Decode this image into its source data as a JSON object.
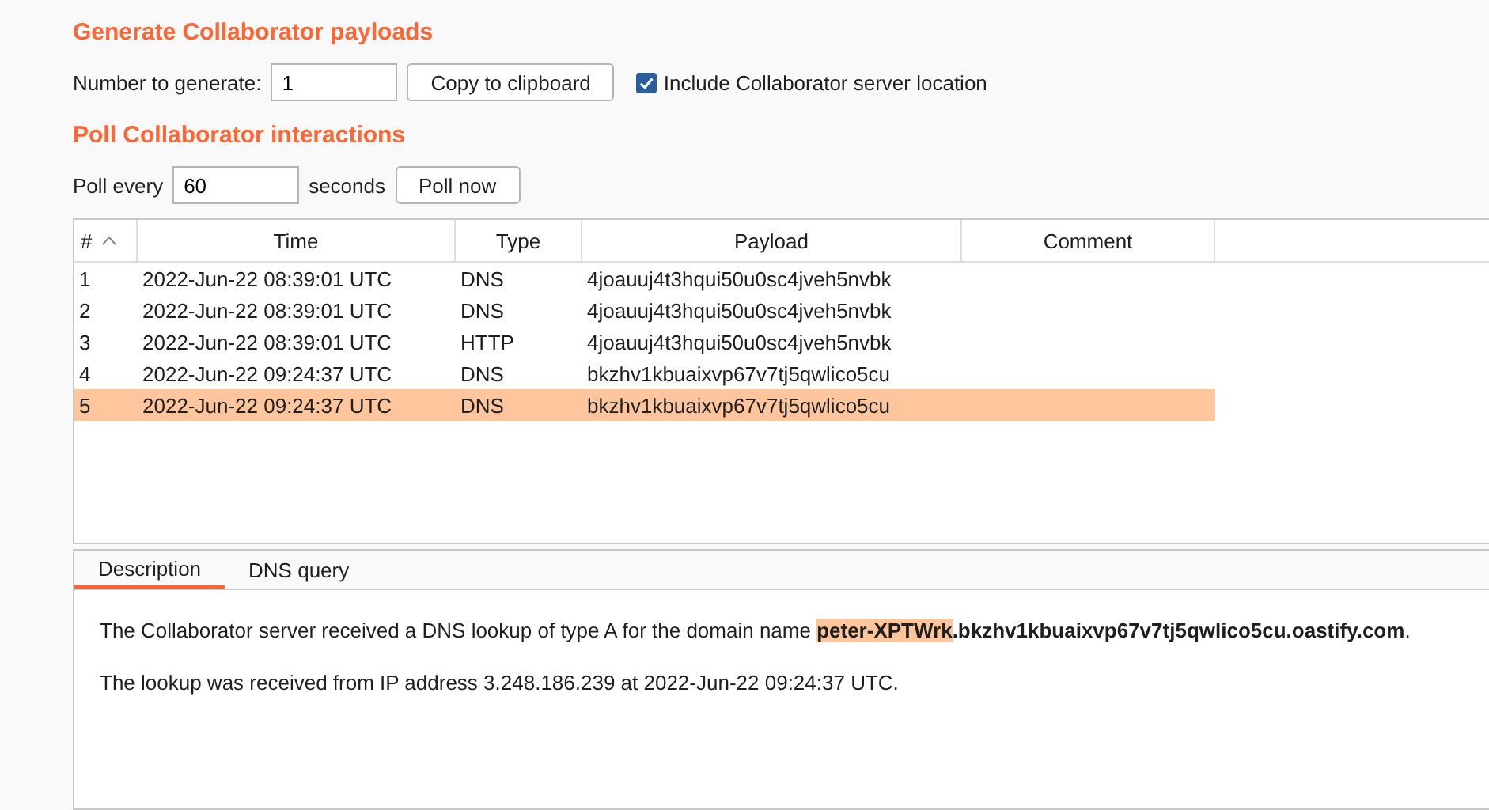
{
  "generate": {
    "title": "Generate Collaborator payloads",
    "number_label": "Number to generate:",
    "number_value": "1",
    "copy_button": "Copy to clipboard",
    "include_location": {
      "label": "Include Collaborator server location",
      "checked": true
    }
  },
  "poll": {
    "title": "Poll Collaborator interactions",
    "label_before": "Poll every",
    "interval_value": "60",
    "label_after": "seconds",
    "poll_button": "Poll now"
  },
  "table": {
    "columns": [
      "#",
      "Time",
      "Type",
      "Payload",
      "Comment"
    ],
    "rows": [
      {
        "cells": [
          "1",
          "2022-Jun-22 08:39:01 UTC",
          "DNS",
          "4joauuj4t3hqui50u0sc4jveh5nvbk",
          ""
        ],
        "selected": false
      },
      {
        "cells": [
          "2",
          "2022-Jun-22 08:39:01 UTC",
          "DNS",
          "4joauuj4t3hqui50u0sc4jveh5nvbk",
          ""
        ],
        "selected": false
      },
      {
        "cells": [
          "3",
          "2022-Jun-22 08:39:01 UTC",
          "HTTP",
          "4joauuj4t3hqui50u0sc4jveh5nvbk",
          ""
        ],
        "selected": false
      },
      {
        "cells": [
          "4",
          "2022-Jun-22 09:24:37 UTC",
          "DNS",
          "bkzhv1kbuaixvp67v7tj5qwlico5cu",
          ""
        ],
        "selected": false
      },
      {
        "cells": [
          "5",
          "2022-Jun-22 09:24:37 UTC",
          "DNS",
          "bkzhv1kbuaixvp67v7tj5qwlico5cu",
          ""
        ],
        "selected": true
      }
    ]
  },
  "detail": {
    "tabs": [
      {
        "label": "Description",
        "selected": true
      },
      {
        "label": "DNS query",
        "selected": false
      }
    ],
    "paragraphs": [
      [
        {
          "kind": "plain",
          "text": "The Collaborator server received a DNS lookup of type A for the domain name "
        },
        {
          "kind": "highlight",
          "text": "peter-XPTWrk"
        },
        {
          "kind": "bold",
          "text": ".bkzhv1kbuaixvp67v7tj5qwlico5cu.oastify.com"
        },
        {
          "kind": "plain",
          "text": "."
        }
      ],
      [
        {
          "kind": "plain",
          "text": "The lookup was received from IP address 3.248.186.239 at 2022-Jun-22 09:24:37 UTC."
        }
      ]
    ]
  }
}
